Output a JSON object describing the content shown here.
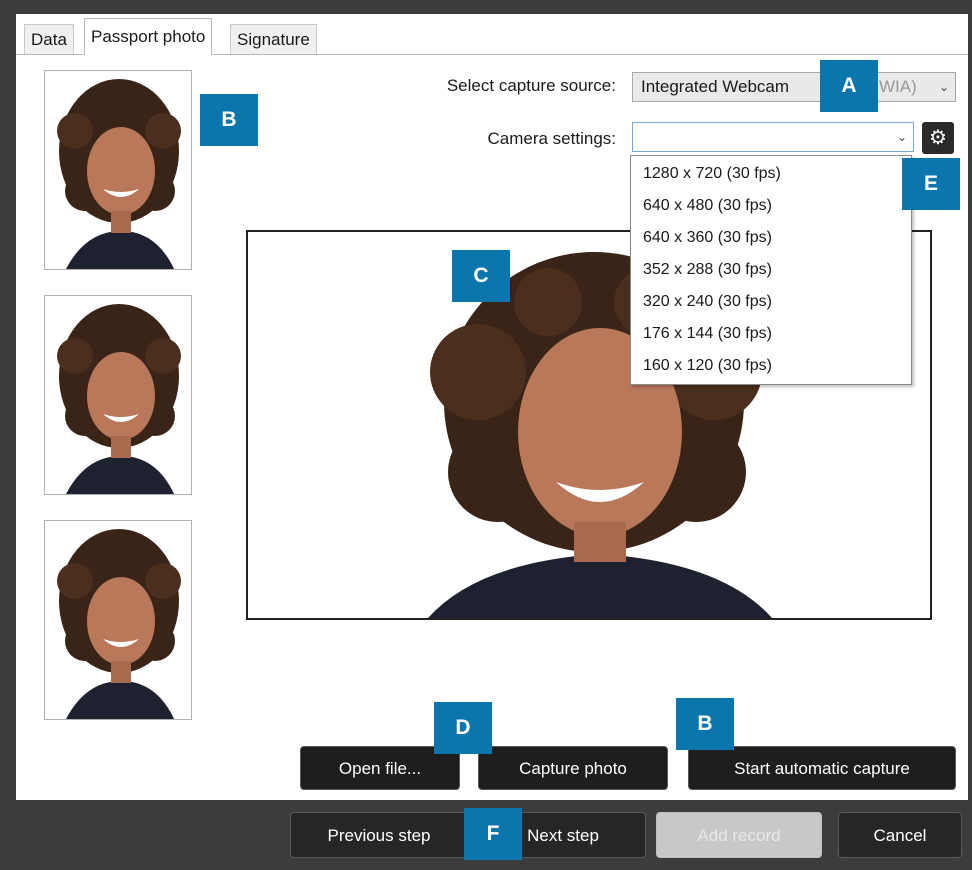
{
  "tabs": [
    {
      "label": "Data"
    },
    {
      "label": "Passport photo"
    },
    {
      "label": "Signature"
    }
  ],
  "capture_source": {
    "label": "Select capture source:",
    "value": "Integrated Webcam",
    "value_suffix": "WIA)"
  },
  "camera_settings": {
    "label": "Camera settings:",
    "value": "",
    "options": [
      "1280 x 720 (30 fps)",
      "640 x 480 (30 fps)",
      "640 x 360 (30 fps)",
      "352 x 288 (30 fps)",
      "320 x 240 (30 fps)",
      "176 x 144 (30 fps)",
      "160 x 120 (30 fps)"
    ]
  },
  "actions": {
    "open_file": "Open file...",
    "capture_photo": "Capture photo",
    "start_auto": "Start automatic capture"
  },
  "footer": {
    "previous": "Previous step",
    "next": "Next step",
    "add_record": "Add record",
    "cancel": "Cancel"
  },
  "markers": {
    "a": "A",
    "b_top": "B",
    "c": "C",
    "d": "D",
    "b_bottom": "B",
    "e": "E",
    "f": "F"
  },
  "colors": {
    "marker": "#0a76ad",
    "dark_button": "#1e1e1e",
    "frame": "#3c3c3c"
  }
}
